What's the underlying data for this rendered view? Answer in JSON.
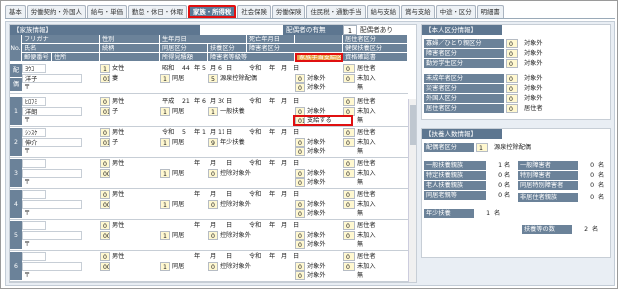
{
  "tabs": [
    "基本",
    "労働契約・外国人",
    "給与・単価",
    "勤怠・休日・休暇",
    "家族・所得税",
    "社会保険",
    "労働保険",
    "住民税・通勤手当",
    "給与支給",
    "賞与支給",
    "中途・区分",
    "明細書"
  ],
  "active_tab": 4,
  "family": {
    "title": "【家族情報】",
    "spouse_label": "配偶者の有無",
    "spouse_value": "1",
    "spouse_text": "配偶者あり",
    "col_headers": {
      "no": "No.",
      "furigana": "フリガナ",
      "name": "氏名",
      "postal": "郵便番号",
      "address": "住所",
      "gender": "性別",
      "relation": "続柄",
      "birth": "生年月日",
      "cohabit": "同居区分",
      "death": "死亡年月日",
      "dep_cat": "扶養区分",
      "income": "所得見積額",
      "disability": "障害者区分",
      "disability_lv": "障害者等級等",
      "residence": "居住者区分",
      "health_ins": "健保扶養区分",
      "family_allow": "家族手当支給区分",
      "qual_date": "資格確認書"
    },
    "spouse": {
      "label1": "配",
      "label2": "偶",
      "furigana": "ﾖｳｺ",
      "name": "洋子",
      "postal_mark": "〒",
      "gender_code": "1",
      "gender": "女性",
      "relation_code": "01",
      "relation": "妻",
      "era": "昭和",
      "year": "44",
      "ymd_y": "年",
      "month": "5",
      "ymd_m": "月",
      "day": "6",
      "ymd_d": "日",
      "cohabit_code": "1",
      "cohabit": "同居",
      "dep_code": "5",
      "dep": "源泉控除配偶",
      "death_era": "令和",
      "death_y": "年",
      "death_m": "月",
      "death_d": "日",
      "disability_code": "0",
      "disability": "対象外",
      "residence_code": "0",
      "residence": "居住者",
      "health_code": "0",
      "health": "未加入",
      "allow_code": "0",
      "allow": "対象外",
      "qual": "無"
    },
    "rows": [
      {
        "no": "1",
        "furigana": "ﾋﾛﾌﾐ",
        "name": "洋朗",
        "gender_code": "0",
        "gender": "男性",
        "relation_code": "01",
        "relation": "子",
        "era": "平成",
        "year": "21",
        "month": "6",
        "day": "30",
        "cohabit_code": "1",
        "cohabit": "同居",
        "dep_code": "1",
        "dep": "一般扶養",
        "disability_code": "0",
        "disability": "対象外",
        "residence_code": "0",
        "residence": "居住者",
        "health_code": "0",
        "health": "未加入",
        "allow_code": "01",
        "allow": "支給する",
        "qual": "無"
      },
      {
        "no": "2",
        "furigana": "ｼﾝｽｹ",
        "name": "伸介",
        "gender_code": "0",
        "gender": "男性",
        "relation_code": "01",
        "relation": "子",
        "era": "令和",
        "year": "5",
        "month": "1",
        "day": "11",
        "cohabit_code": "1",
        "cohabit": "同居",
        "dep_code": "9",
        "dep": "年少扶養",
        "disability_code": "0",
        "disability": "対象外",
        "residence_code": "0",
        "residence": "居住者",
        "health_code": "0",
        "health": "未加入",
        "allow_code": "0",
        "allow": "対象外",
        "qual": "無"
      },
      {
        "no": "3",
        "furigana": "",
        "name": "",
        "gender_code": "0",
        "gender": "男性",
        "relation_code": "00",
        "relation": "",
        "era": "",
        "year": "",
        "month": "",
        "day": "",
        "cohabit_code": "1",
        "cohabit": "同居",
        "dep_code": "0",
        "dep": "控除対象外",
        "disability_code": "0",
        "disability": "対象外",
        "residence_code": "0",
        "residence": "居住者",
        "health_code": "0",
        "health": "未加入",
        "allow_code": "0",
        "allow": "対象外",
        "qual": "無"
      },
      {
        "no": "4",
        "furigana": "",
        "name": "",
        "gender_code": "0",
        "gender": "男性",
        "relation_code": "00",
        "relation": "",
        "era": "",
        "year": "",
        "month": "",
        "day": "",
        "cohabit_code": "1",
        "cohabit": "同居",
        "dep_code": "0",
        "dep": "控除対象外",
        "disability_code": "0",
        "disability": "対象外",
        "residence_code": "0",
        "residence": "居住者",
        "health_code": "0",
        "health": "未加入",
        "allow_code": "0",
        "allow": "対象外",
        "qual": "無"
      },
      {
        "no": "5",
        "furigana": "",
        "name": "",
        "gender_code": "0",
        "gender": "男性",
        "relation_code": "00",
        "relation": "",
        "era": "",
        "year": "",
        "month": "",
        "day": "",
        "cohabit_code": "1",
        "cohabit": "同居",
        "dep_code": "0",
        "dep": "控除対象外",
        "disability_code": "0",
        "disability": "対象外",
        "residence_code": "0",
        "residence": "居住者",
        "health_code": "0",
        "health": "未加入",
        "allow_code": "0",
        "allow": "対象外",
        "qual": "無"
      },
      {
        "no": "6",
        "furigana": "",
        "name": "",
        "gender_code": "0",
        "gender": "男性",
        "relation_code": "00",
        "relation": "",
        "era": "",
        "year": "",
        "month": "",
        "day": "",
        "cohabit_code": "1",
        "cohabit": "同居",
        "dep_code": "0",
        "dep": "控除対象外",
        "disability_code": "0",
        "disability": "対象外",
        "residence_code": "0",
        "residence": "居住者",
        "health_code": "0",
        "health": "未加入",
        "allow_code": "0",
        "allow": "対象外",
        "qual": "無"
      }
    ],
    "ymd": {
      "y": "年",
      "m": "月",
      "d": "日",
      "reiwa": "令和"
    },
    "postal_mark": "〒"
  },
  "self": {
    "title": "【本人区分情報】",
    "rows": [
      {
        "label": "寡婦／ひとり親区分",
        "code": "0",
        "text": "対象外"
      },
      {
        "label": "障害者区分",
        "code": "0",
        "text": "対象外"
      },
      {
        "label": "勤労学生区分",
        "code": "0",
        "text": "対象外"
      },
      {
        "label": "未成年者区分",
        "code": "0",
        "text": "対象外"
      },
      {
        "label": "災害者区分",
        "code": "0",
        "text": "対象外"
      },
      {
        "label": "外国人区分",
        "code": "0",
        "text": "対象外"
      },
      {
        "label": "居住者区分",
        "code": "0",
        "text": "居住者"
      }
    ]
  },
  "dependents": {
    "title": "【扶養人数情報】",
    "spouse_label": "配偶者区分",
    "spouse_code": "1",
    "spouse_text": "源泉控除配偶",
    "left": [
      {
        "label": "一般扶養親族",
        "value": "1",
        "unit": "名"
      },
      {
        "label": "特定扶養親族",
        "value": "0",
        "unit": "名"
      },
      {
        "label": "老人扶養親族",
        "value": "0",
        "unit": "名"
      },
      {
        "label": "同居老親等",
        "value": "0",
        "unit": "名"
      }
    ],
    "right": [
      {
        "label": "一般障害者",
        "value": "0",
        "unit": "名"
      },
      {
        "label": "特別障害者",
        "value": "0",
        "unit": "名"
      },
      {
        "label": "同居特別障害者",
        "value": "0",
        "unit": "名"
      }
    ],
    "nonresident_label": "非居住者親族",
    "nonresident_value": "0",
    "nonresident_unit": "名",
    "minor_label": "年少扶養",
    "minor_value": "1",
    "minor_unit": "名",
    "total_label": "扶養等の数",
    "total_value": "2",
    "total_unit": "名"
  }
}
